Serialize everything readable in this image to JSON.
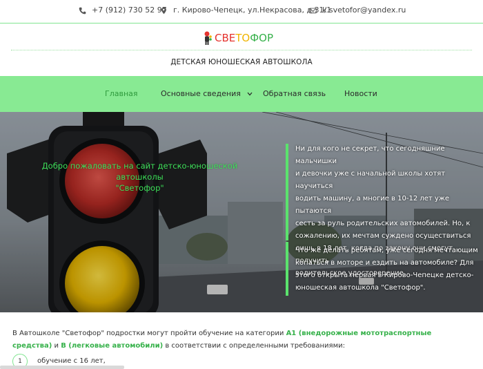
{
  "topbar": {
    "phone": "+7 (912) 730 52 97",
    "address": "г. Кирово-Чепецк, ул.Некрасова, д.31/1",
    "email": "k.svetofor@yandex.ru",
    "phone_icon": "phone-icon",
    "address_icon": "map-pin-icon",
    "email_icon": "envelope-icon"
  },
  "logo": {
    "part1": "СВЕ",
    "part2": "ТО",
    "part3": "ФОР",
    "icon": "logo-figure-icon"
  },
  "header": {
    "subtitle": "ДЕТСКАЯ ЮНОШЕСКАЯ АВТОШКОЛА"
  },
  "nav": {
    "items": [
      {
        "label": "Главная"
      },
      {
        "label": "Основные сведения",
        "chevron": "chevron-down-icon"
      },
      {
        "label": "Обратная связь"
      },
      {
        "label": "Новости"
      }
    ]
  },
  "hero": {
    "welcome_line1": "Добро пожаловать на сайт детско-юношеской автошколы",
    "welcome_line2": "\"Светофор\"",
    "para1": [
      "Ни для кого не секрет, что сегодняшние мальчишки",
      "и девочки уже с начальной школы хотят научиться",
      "водить машину, а многие в 10-12 лет уже пытаются",
      "сесть за руль родительских автомобилей. Но, к",
      "сожалению, их мечтам суждено осуществиться",
      "лишь в 18 лет, когда по закону они смогут получить",
      "водительское удостоверение."
    ],
    "para2": [
      "Что же делать ребятам, уже сегодня мечтающим",
      "копаться в моторе и ездить на автомобиле? Для",
      "этого открыта первая в Кирово-Чепецке детско-",
      "юношеская  автошкола \"Светофор\"."
    ]
  },
  "content": {
    "intro_a": "В Автошколе  \"Светофор\" подростки могут пройти обучение на категории ",
    "intro_cat1": "А1 (внедорожные мототраспортные средства)",
    "intro_b": " и  ",
    "intro_cat2": "В (легковые автомобили)",
    "intro_c": " в соответствии с определенными требованиями:",
    "list": [
      {
        "num": "1",
        "text": "обучение с 16 лет,"
      }
    ]
  },
  "colors": {
    "accent_green": "#88ea93",
    "text_green": "#36b14a",
    "welcome_green": "#3ee05a"
  }
}
